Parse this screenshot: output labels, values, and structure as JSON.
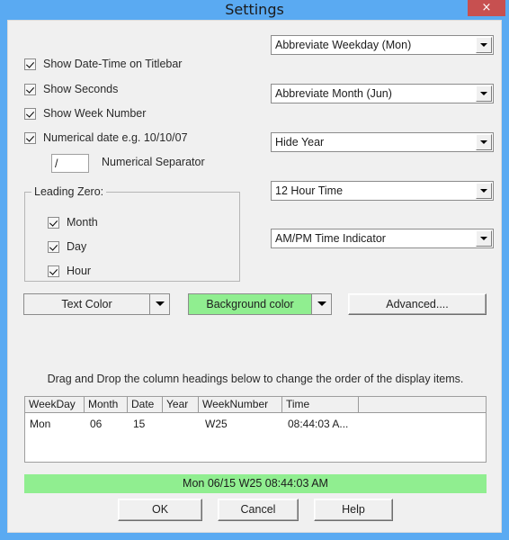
{
  "window": {
    "title": "Settings",
    "close_label": "×",
    "titlebar_color": "#5aaaf2",
    "close_color": "#c75050",
    "client_color": "#f0f0f0"
  },
  "checkboxes": [
    {
      "label": "Show Date-Time on Titlebar",
      "checked": true
    },
    {
      "label": "Show Seconds",
      "checked": true
    },
    {
      "label": "Show Week Number",
      "checked": true
    },
    {
      "label": "Numerical date e.g. 10/10/07",
      "checked": true
    }
  ],
  "separator": {
    "value": "/",
    "label": "Numerical Separator"
  },
  "leading_zero": {
    "title": "Leading Zero:",
    "items": [
      {
        "label": "Month",
        "checked": true
      },
      {
        "label": "Day",
        "checked": true
      },
      {
        "label": "Hour",
        "checked": true
      }
    ]
  },
  "dropdowns": [
    {
      "value": "Abbreviate Weekday (Mon)"
    },
    {
      "value": "Abbreviate Month (Jun)"
    },
    {
      "value": "Hide Year"
    },
    {
      "value": "12 Hour Time"
    },
    {
      "value": "AM/PM Time Indicator"
    }
  ],
  "color_buttons": {
    "text_color": {
      "label": "Text Color",
      "swatch": "#f0f0f0"
    },
    "background_color": {
      "label": "Background color",
      "swatch": "#90ee90"
    },
    "advanced": {
      "label": "Advanced...."
    }
  },
  "hint": "Drag and Drop the column headings below to change the order of the display items.",
  "listview": {
    "columns": [
      "WeekDay",
      "Month",
      "Date",
      "Year",
      "WeekNumber",
      "Time",
      ""
    ],
    "rows": [
      {
        "WeekDay": "Mon",
        "Month": "06",
        "Date": "15",
        "Year": "",
        "WeekNumber": "W25",
        "Time": "08:44:03 A..."
      }
    ]
  },
  "preview": {
    "text": "Mon  06/15  W25  08:44:03 AM",
    "background": "#90ee90"
  },
  "buttons": {
    "ok": "OK",
    "cancel": "Cancel",
    "help": "Help"
  }
}
